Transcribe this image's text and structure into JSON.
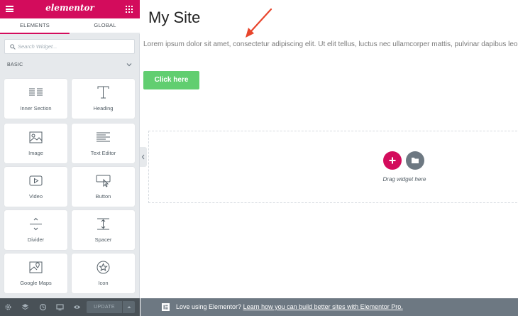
{
  "sidebar": {
    "brand": "elementor",
    "tabs": [
      {
        "label": "ELEMENTS"
      },
      {
        "label": "GLOBAL"
      }
    ],
    "search": {
      "placeholder": "Search Widget..."
    },
    "category": "BASIC",
    "widgets": [
      {
        "label": "Inner Section",
        "icon": "inner-section-icon"
      },
      {
        "label": "Heading",
        "icon": "heading-icon"
      },
      {
        "label": "Image",
        "icon": "image-icon"
      },
      {
        "label": "Text Editor",
        "icon": "text-editor-icon"
      },
      {
        "label": "Video",
        "icon": "video-icon"
      },
      {
        "label": "Button",
        "icon": "button-icon"
      },
      {
        "label": "Divider",
        "icon": "divider-icon"
      },
      {
        "label": "Spacer",
        "icon": "spacer-icon"
      },
      {
        "label": "Google Maps",
        "icon": "google-maps-icon"
      },
      {
        "label": "Icon",
        "icon": "star-icon"
      }
    ],
    "footer": {
      "update_label": "UPDATE"
    }
  },
  "canvas": {
    "title": "My Site",
    "body": "Lorem ipsum dolor sit amet, consectetur adipiscing elit. Ut elit tellus, luctus nec ullamcorper mattis, pulvinar dapibus leo.",
    "button_label": "Click here",
    "dropzone_text": "Drag widget here"
  },
  "promo": {
    "prefix": "Love using Elementor?",
    "link": "Learn how you can build better sites with Elementor Pro."
  },
  "colors": {
    "brand": "#d30c5c",
    "button": "#61ce70",
    "arrow": "#e8452c",
    "panel": "#e6e9ec",
    "footer": "#495157"
  }
}
